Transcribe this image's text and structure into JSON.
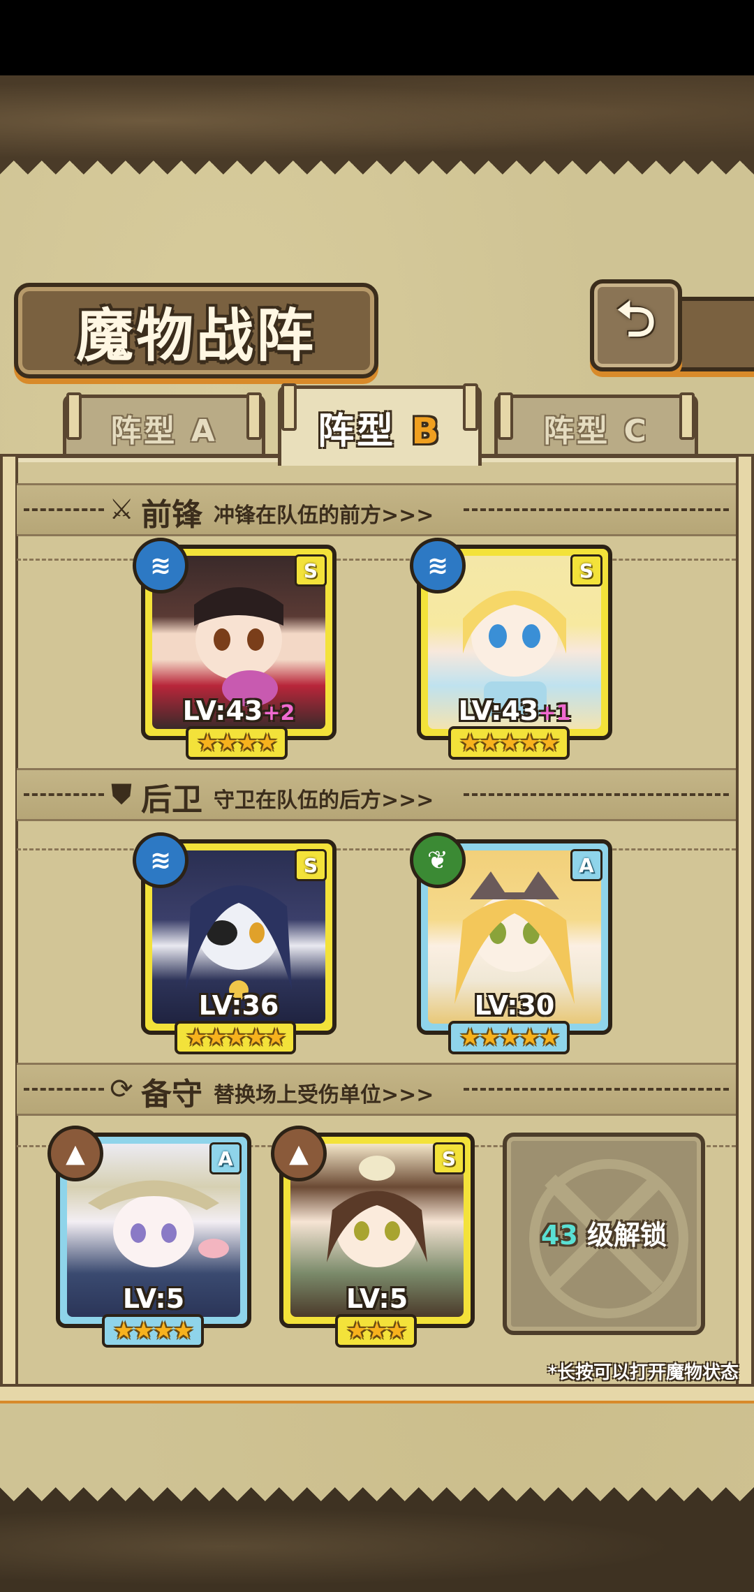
{
  "title": "魔物战阵",
  "back_icon": "return-arrow-icon",
  "tabs": [
    {
      "label_prefix": "阵型",
      "label_letter": "A",
      "active": false
    },
    {
      "label_prefix": "阵型",
      "label_letter": "B",
      "active": true
    },
    {
      "label_prefix": "阵型",
      "label_letter": "C",
      "active": false
    }
  ],
  "sections": {
    "front": {
      "name": "前锋",
      "desc": "冲锋在队伍的前方>>>",
      "icon": "sword-icon"
    },
    "back": {
      "name": "后卫",
      "desc": "守卫在队伍的后方>>>",
      "icon": "shield-icon"
    },
    "reserve": {
      "name": "备守",
      "desc": "替换场上受伤单位>>>",
      "icon": "swap-icon"
    }
  },
  "units": {
    "front1": {
      "rank": "S",
      "element": "water",
      "level": "LV:43",
      "bonus": "+2",
      "stars": 4
    },
    "front2": {
      "rank": "S",
      "element": "water",
      "level": "LV:43",
      "bonus": "+1",
      "stars": 5
    },
    "back1": {
      "rank": "S",
      "element": "water",
      "level": "LV:36",
      "bonus": "",
      "stars": 5
    },
    "back2": {
      "rank": "A",
      "element": "wind",
      "level": "LV:30",
      "bonus": "",
      "stars": 5
    },
    "reserve1": {
      "rank": "A",
      "element": "earth",
      "level": "LV:5",
      "bonus": "",
      "stars": 4
    },
    "reserve2": {
      "rank": "S",
      "element": "earth",
      "level": "LV:5",
      "bonus": "",
      "stars": 3
    }
  },
  "locked_slot": {
    "level": "43",
    "text": "级解锁"
  },
  "hint": "*长按可以打开魔物状态",
  "star_glyphs": {
    "3": "★★★",
    "4": "★★★★",
    "5": "★★★★★"
  },
  "element_glyphs": {
    "water": "≋",
    "wind": "❦",
    "earth": "▲"
  },
  "colors": {
    "rank_s": "#f3e23a",
    "rank_a": "#8fd4ea",
    "water": "#2d79c4",
    "wind": "#3b8a34",
    "earth": "#8a5a3a",
    "accent": "#f0a020"
  }
}
